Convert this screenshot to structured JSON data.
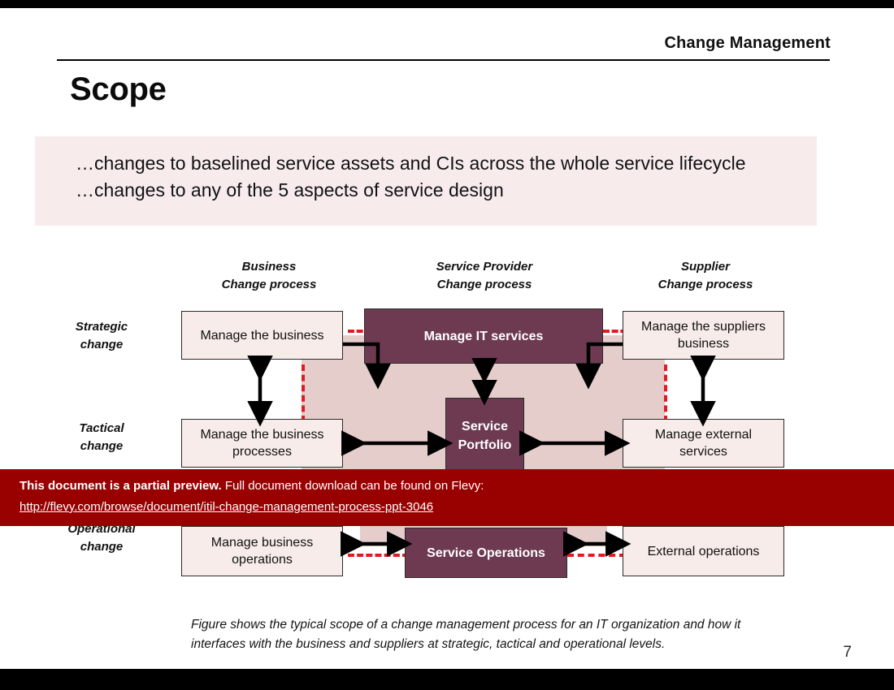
{
  "header": {
    "title": "Change Management",
    "slide_title": "Scope"
  },
  "callout": {
    "line1": "…changes to baselined service assets and CIs across the whole service lifecycle",
    "line2": "…changes to any of the 5 aspects of service design"
  },
  "diagram": {
    "column_headers": [
      {
        "line1": "Business",
        "line2": "Change process"
      },
      {
        "line1": "Service Provider",
        "line2": "Change process"
      },
      {
        "line1": "Supplier",
        "line2": "Change process"
      }
    ],
    "row_labels": [
      {
        "line1": "Strategic",
        "line2": "change"
      },
      {
        "line1": "Tactical",
        "line2": "change"
      },
      {
        "line1": "Operational",
        "line2": "change"
      }
    ],
    "nodes": {
      "strategic_business": "Manage the business",
      "strategic_provider": "Manage IT services",
      "strategic_supplier_l1": "Manage the suppliers",
      "strategic_supplier_l2": "business",
      "tactical_business_l1": "Manage the business",
      "tactical_business_l2": "processes",
      "tactical_provider_l1": "Service",
      "tactical_provider_l2": "Portfolio",
      "tactical_supplier_l1": "Manage external",
      "tactical_supplier_l2": "services",
      "operational_business_l1": "Manage business",
      "operational_business_l2": "operations",
      "operational_provider": "Service Operations",
      "operational_supplier": "External operations"
    },
    "colors": {
      "node_dark": "#6e3a52",
      "node_light": "#f7ece9",
      "field_pink": "#e5cdcb",
      "dashed_boundary": "#e11b22",
      "callout_band": "#f7eceb"
    }
  },
  "caption": {
    "line1": "Figure shows the typical scope of a change management process for an IT organization and how it",
    "line2": "interfaces with the business and suppliers at strategic, tactical and operational levels."
  },
  "page_number": "7",
  "preview_banner": {
    "strong": "This document is a partial preview.",
    "rest": "Full document download can be found on Flevy:",
    "link": "http://flevy.com/browse/document/itil-change-management-process-ppt-3046",
    "background": "#990000"
  }
}
